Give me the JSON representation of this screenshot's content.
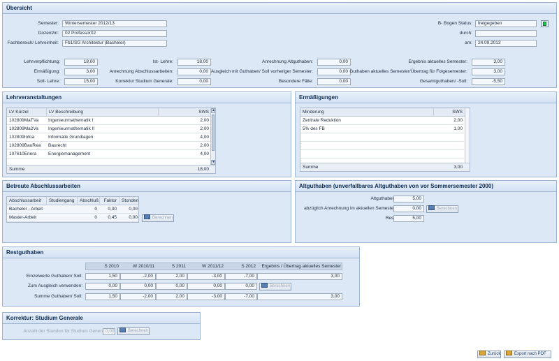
{
  "overview": {
    "title": "Übersicht",
    "semester_label": "Semester:",
    "semester_value": "Wintersemester 2012/13",
    "dozent_label": "Dozent/in:",
    "dozent_value": "02 Professor02",
    "fach_label": "Fachbereich/ Lehreinheit:",
    "fach_value": "Fb1/SG Architektur (Bachelor)",
    "status_label": "B- Bogen Status:",
    "status_value": "freigegeben",
    "durch_label": "durch:",
    "durch_value": "",
    "am_label": "am:",
    "am_value": "24.09.2013",
    "status_color": "#22c84a",
    "c1": [
      {
        "label": "Lehrverpflichtung:",
        "value": "18,00"
      },
      {
        "label": "Ermäßigung:",
        "value": "3,00"
      },
      {
        "label": "Soll- Lehre:",
        "value": "15,00"
      }
    ],
    "c2": [
      {
        "label": "Ist- Lehre:",
        "value": "18,00"
      },
      {
        "label": "Anrechnung Abschlussarbeiten:",
        "value": "0,00"
      },
      {
        "label": "Korrektur Studium Generale:",
        "value": "0,00"
      }
    ],
    "c3": [
      {
        "label": "Anrechnung Altguthaben:",
        "value": "0,00"
      },
      {
        "label": "Ausgleich mit Guthaben/ Soll vorheriger Semester:",
        "value": "0,00"
      },
      {
        "label": "Besondere Fälle:",
        "value": "0,00"
      }
    ],
    "c4": [
      {
        "label": "Ergebnis aktuelles Semester:",
        "value": "3,00"
      },
      {
        "label": "Guthaben aktuelles Semester/Übertrag für Folgesemester:",
        "value": "3,00"
      },
      {
        "label": "Gesamtguthaben/ -Soll:",
        "value": "-5,50"
      }
    ]
  },
  "lv": {
    "title": "Lehrveranstaltungen",
    "headers": [
      "LV Kürzel",
      "LV Beschreibung",
      "SWS"
    ],
    "rows": [
      {
        "k": "102809MaTVa",
        "d": "Ingenieurmathematik I",
        "s": "2,00"
      },
      {
        "k": "102809Ma2Va",
        "d": "Ingenieurmathematik II",
        "s": "2,00"
      },
      {
        "k": "102809Infoa",
        "d": "Informatik Grundlagen",
        "s": "4,00"
      },
      {
        "k": "102809BauRea",
        "d": "Baurecht",
        "s": "2,00"
      },
      {
        "k": "107610Enera",
        "d": "Energiemanagement",
        "s": "4,00"
      }
    ],
    "sum_label": "Summe",
    "sum_value": "18,00"
  },
  "erm": {
    "title": "Ermäßigungen",
    "headers": [
      "Minderung",
      "SWS"
    ],
    "rows": [
      {
        "m": "Zentrale Reduktion",
        "s": "2,00"
      },
      {
        "m": "5% des FB",
        "s": "1,00"
      }
    ],
    "sum_label": "Summe",
    "sum_value": "3,00"
  },
  "ba": {
    "title": "Betreute Abschlussarbeiten",
    "headers": [
      "Abschlussarbeit",
      "Studiengang",
      "Abschluß",
      "Faktor",
      "Stunden"
    ],
    "rows": [
      {
        "a": "Bachelor - Arbeit",
        "sg": "",
        "ab": "0",
        "f": "0,30",
        "st": "0,00"
      },
      {
        "a": "Master-Arbeit",
        "sg": "",
        "ab": "0",
        "f": "0,45",
        "st": "0,00"
      }
    ],
    "btn": "Berechnen"
  },
  "alt": {
    "title": "Altguthaben (unverfallbares Altguthaben von vor Sommersemester 2000)",
    "r1_label": "Altguthaben:",
    "r1_value": "5,00",
    "r2_label": "abzüglich Anrechnung im aktuellen Semester:",
    "r2_value": "0,00",
    "r3_label": "Rest:",
    "r3_value": "5,00",
    "btn": "Berechnen"
  },
  "rest": {
    "title": "Restguthaben",
    "headers": [
      "S 2010",
      "W 2010/11",
      "S 2011",
      "W 2011/12",
      "S 2012",
      "Ergebnis / Übertrag aktuelles Semester"
    ],
    "rows": [
      {
        "label": "Einzelwerte Guthaben/ Soll:",
        "v": [
          "1,50",
          "-2,00",
          "2,00",
          "-3,00",
          "-7,00",
          "3,00"
        ]
      },
      {
        "label": "Zum Ausgleich verwenden:",
        "v": [
          "0,00",
          "0,00",
          "0,00",
          "0,00",
          "0,00",
          ""
        ]
      },
      {
        "label": "Summe Guthaben/ Soll:",
        "v": [
          "1,50",
          "-2,00",
          "2,00",
          "-3,00",
          "-7,00",
          "3,00"
        ]
      }
    ],
    "btn": "Berechnen"
  },
  "korr": {
    "title": "Korrektur: Studium Generale",
    "label": "Anzahl der Stunden für Studium Generale:",
    "value": "0,00",
    "btn": "Berechnen"
  },
  "footer": {
    "back": "Zurück",
    "pdf": "Export nach PDF"
  }
}
